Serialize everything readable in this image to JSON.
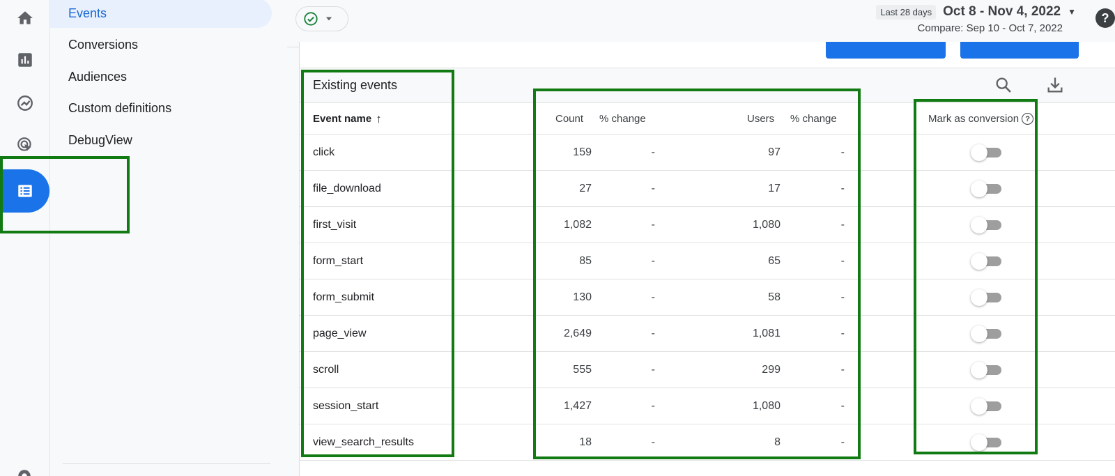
{
  "rail": {
    "icons": [
      "home-icon",
      "reports-icon",
      "explore-icon",
      "advertising-icon",
      "configure-icon",
      "settings-icon"
    ]
  },
  "subnav": {
    "items": [
      {
        "label": "Events",
        "active": true
      },
      {
        "label": "Conversions",
        "active": false
      },
      {
        "label": "Audiences",
        "active": false
      },
      {
        "label": "Custom definitions",
        "active": false
      },
      {
        "label": "DebugView",
        "active": false
      }
    ]
  },
  "header": {
    "date_chip": "Last 28 days",
    "date_range": "Oct 8 - Nov 4, 2022",
    "compare": "Compare: Sep 10 - Oct 7, 2022",
    "help": "?"
  },
  "card": {
    "title": "Existing events",
    "columns": {
      "event_name": "Event name",
      "sort_arrow": "↑",
      "count": "Count",
      "count_change": "% change",
      "users": "Users",
      "users_change": "% change",
      "mark_conversion": "Mark as conversion",
      "help": "?"
    },
    "rows": [
      {
        "name": "click",
        "count": "159",
        "count_change": "-",
        "users": "97",
        "users_change": "-",
        "conversion": false
      },
      {
        "name": "file_download",
        "count": "27",
        "count_change": "-",
        "users": "17",
        "users_change": "-",
        "conversion": false
      },
      {
        "name": "first_visit",
        "count": "1,082",
        "count_change": "-",
        "users": "1,080",
        "users_change": "-",
        "conversion": false
      },
      {
        "name": "form_start",
        "count": "85",
        "count_change": "-",
        "users": "65",
        "users_change": "-",
        "conversion": false
      },
      {
        "name": "form_submit",
        "count": "130",
        "count_change": "-",
        "users": "58",
        "users_change": "-",
        "conversion": false
      },
      {
        "name": "page_view",
        "count": "2,649",
        "count_change": "-",
        "users": "1,081",
        "users_change": "-",
        "conversion": false
      },
      {
        "name": "scroll",
        "count": "555",
        "count_change": "-",
        "users": "299",
        "users_change": "-",
        "conversion": false
      },
      {
        "name": "session_start",
        "count": "1,427",
        "count_change": "-",
        "users": "1,080",
        "users_change": "-",
        "conversion": false
      },
      {
        "name": "view_search_results",
        "count": "18",
        "count_change": "-",
        "users": "8",
        "users_change": "-",
        "conversion": false
      }
    ]
  },
  "colors": {
    "accent": "#1a73e8",
    "active_bg": "#e8f0fe",
    "highlight": "#127a12",
    "status_ok": "#188038"
  }
}
